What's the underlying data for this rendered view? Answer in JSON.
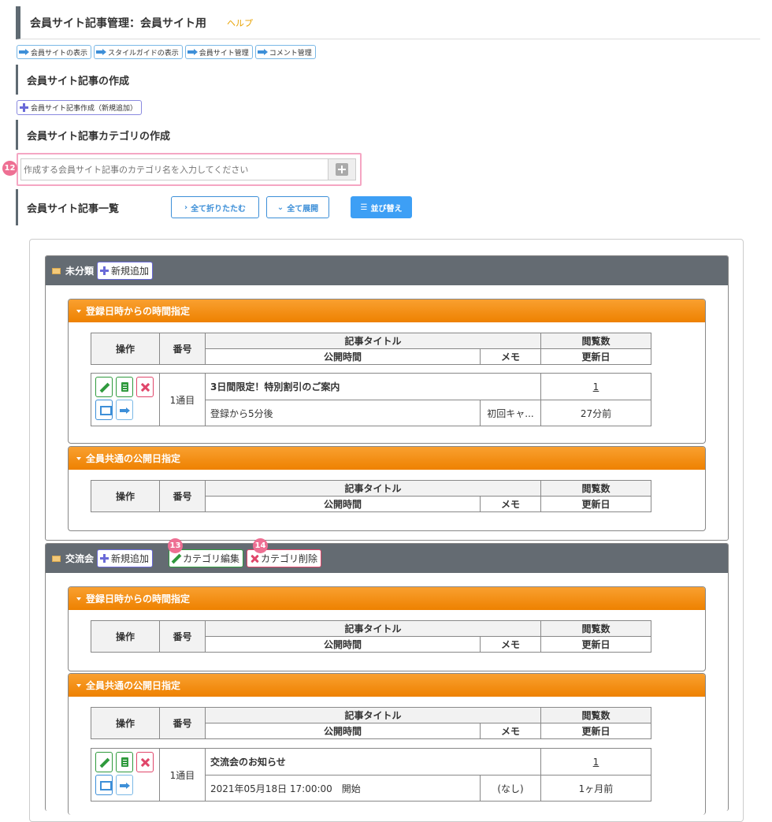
{
  "header": {
    "title": "会員サイト記事管理：会員サイト用",
    "help": "ヘルプ"
  },
  "toplinks": [
    "会員サイトの表示",
    "スタイルガイドの表示",
    "会員サイト管理",
    "コメント管理"
  ],
  "section_create": {
    "title": "会員サイト記事の作成",
    "button": "会員サイト記事作成（新規追加）"
  },
  "section_category": {
    "title": "会員サイト記事カテゴリの作成",
    "placeholder": "作成する会員サイト記事のカテゴリ名を入力してください",
    "badge": "12"
  },
  "section_list": {
    "title": "会員サイト記事一覧",
    "collapse": "全て折りたたむ",
    "expand": "全て展開",
    "sort": "並び替え"
  },
  "table_headers": {
    "ops": "操作",
    "num": "番号",
    "title": "記事タイトル",
    "views": "閲覧数",
    "pubtime": "公開時間",
    "memo": "メモ",
    "updated": "更新日"
  },
  "categories": [
    {
      "name": "未分類",
      "add": "新規追加",
      "sub1": {
        "title": "登録日時からの時間指定",
        "row": {
          "num": "1通目",
          "title": "3日間限定！特別割引のご案内",
          "views": "1",
          "pubtime": "登録から5分後",
          "memo": "初回キャ...",
          "updated": "27分前"
        }
      },
      "sub2": {
        "title": "全員共通の公開日指定"
      }
    },
    {
      "name": "交流会",
      "add": "新規追加",
      "edit": "カテゴリ編集",
      "delete": "カテゴリ削除",
      "badge_edit": "13",
      "badge_delete": "14",
      "sub1": {
        "title": "登録日時からの時間指定"
      },
      "sub2": {
        "title": "全員共通の公開日指定",
        "row": {
          "num": "1通目",
          "title": "交流会のお知らせ",
          "views": "1",
          "pubtime": "2021年05月18日 17:00:00　開始",
          "memo": "(なし)",
          "updated": "1ヶ月前"
        }
      }
    }
  ]
}
